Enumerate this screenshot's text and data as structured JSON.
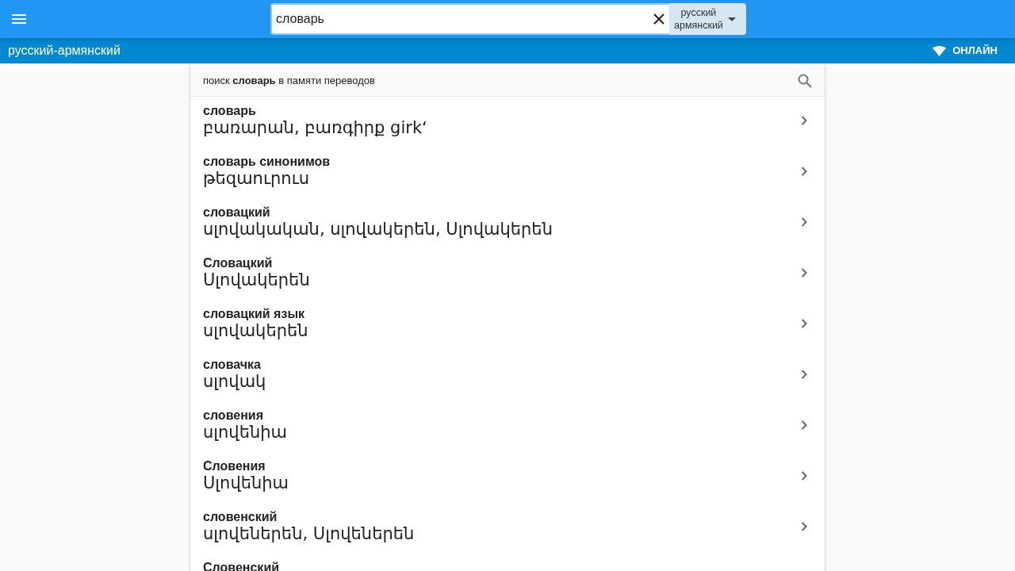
{
  "top_bar": {
    "search": {
      "value": "словарь"
    },
    "language": {
      "source": "русский",
      "target": "армянский"
    }
  },
  "sub_bar": {
    "title": "русский-армянский",
    "status": "ОНЛАЙН"
  },
  "memory_search": "поиск **словарь** в памяти переводов",
  "results": [
    {
      "term": "словарь",
      "translation": "բառարան, բառգիրք girkʻ"
    },
    {
      "term": "словарь синонимов",
      "translation": "թեզաուրուս"
    },
    {
      "term": "словацкий",
      "translation": "սլովակական, սլովակերեն, Սլովակերեն"
    },
    {
      "term": "Словацкий",
      "translation": "Սլովակերեն"
    },
    {
      "term": "словацкий язык",
      "translation": "սլովակերեն"
    },
    {
      "term": "словачка",
      "translation": "սլովակ"
    },
    {
      "term": "словения",
      "translation": "սլովենիա"
    },
    {
      "term": "Словения",
      "translation": "Սլովենիա"
    },
    {
      "term": "словенский",
      "translation": "սլովեներեն, Սլովեներեն"
    },
    {
      "term": "Словенский"
    }
  ]
}
